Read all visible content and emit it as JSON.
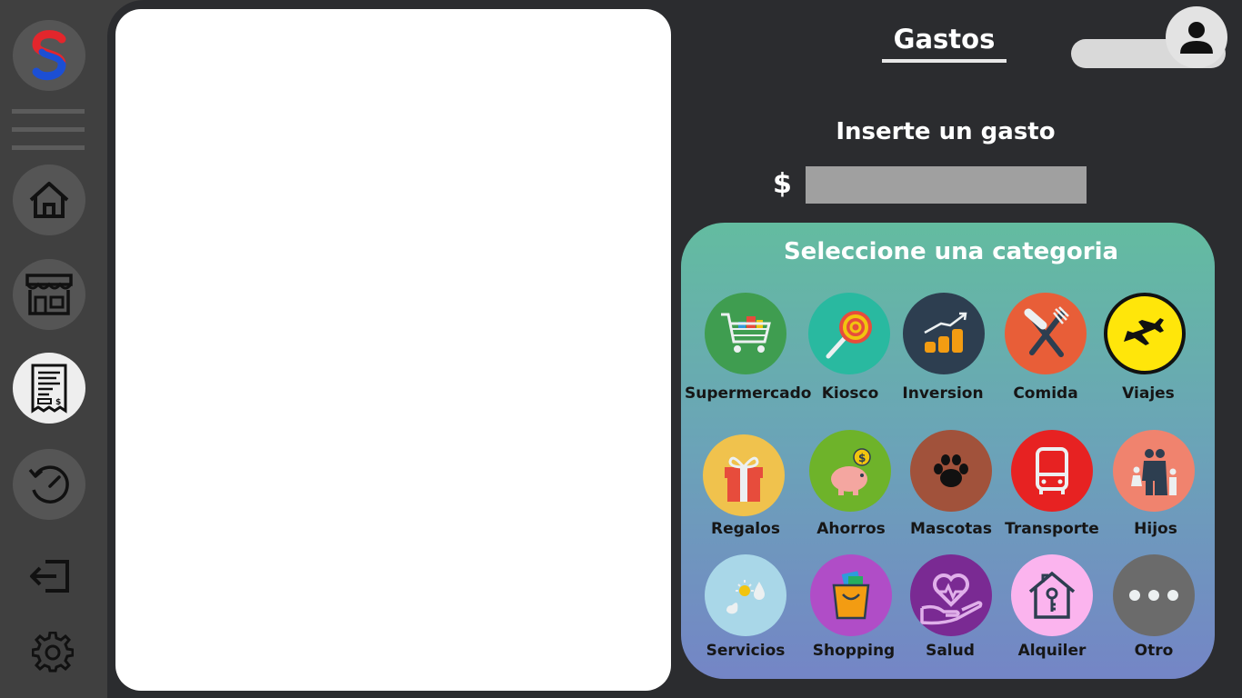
{
  "app": {
    "logo_icon": "brand-s-logo-icon",
    "colors": {
      "sidebar": "#404040",
      "main_bg": "#2b2c2f",
      "panel_top": "#63bca0",
      "panel_bottom": "#7485c6",
      "input": "#a0a0a0"
    }
  },
  "sidebar": {
    "items": [
      {
        "icon": "menu-icon"
      },
      {
        "icon": "home-icon"
      },
      {
        "icon": "store-icon"
      },
      {
        "icon": "receipt-icon",
        "active": true
      },
      {
        "icon": "history-icon"
      },
      {
        "icon": "logout-icon"
      },
      {
        "icon": "gear-icon"
      }
    ]
  },
  "header": {
    "title": "Gastos",
    "user_icon": "user-icon"
  },
  "form": {
    "insert_label": "Inserte un gasto",
    "currency_symbol": "$",
    "amount_value": "",
    "amount_placeholder": ""
  },
  "categories": {
    "title": "Seleccione una categoria",
    "items": [
      {
        "label": "Supermercado",
        "icon": "shopping-cart-icon",
        "color": "#3f9d50"
      },
      {
        "label": "Kiosco",
        "icon": "lollipop-icon",
        "color": "#29b9a0"
      },
      {
        "label": "Inversion",
        "icon": "investment-chart-icon",
        "color": "#2d3e50"
      },
      {
        "label": "Comida",
        "icon": "knife-fork-icon",
        "color": "#e85e38"
      },
      {
        "label": "Viajes",
        "icon": "airplane-icon",
        "color": "#ffe60a"
      },
      {
        "label": "Regalos",
        "icon": "gift-icon",
        "color": "#f0c24d"
      },
      {
        "label": "Ahorros",
        "icon": "piggy-bank-icon",
        "color": "#6eb32a"
      },
      {
        "label": "Mascotas",
        "icon": "paw-icon",
        "color": "#a1523b"
      },
      {
        "label": "Transporte",
        "icon": "bus-icon",
        "color": "#e72222"
      },
      {
        "label": "Hijos",
        "icon": "family-icon",
        "color": "#f0836e"
      },
      {
        "label": "Servicios",
        "icon": "utilities-icon",
        "color": "#a9d7e8"
      },
      {
        "label": "Shopping",
        "icon": "shopping-bag-icon",
        "color": "#b04dc7"
      },
      {
        "label": "Salud",
        "icon": "health-heart-icon",
        "color": "#7a2a93"
      },
      {
        "label": "Alquiler",
        "icon": "house-key-icon",
        "color": "#fbb4ee"
      },
      {
        "label": "Otro",
        "icon": "more-dots-icon",
        "color": "#6b6b6b"
      }
    ]
  }
}
